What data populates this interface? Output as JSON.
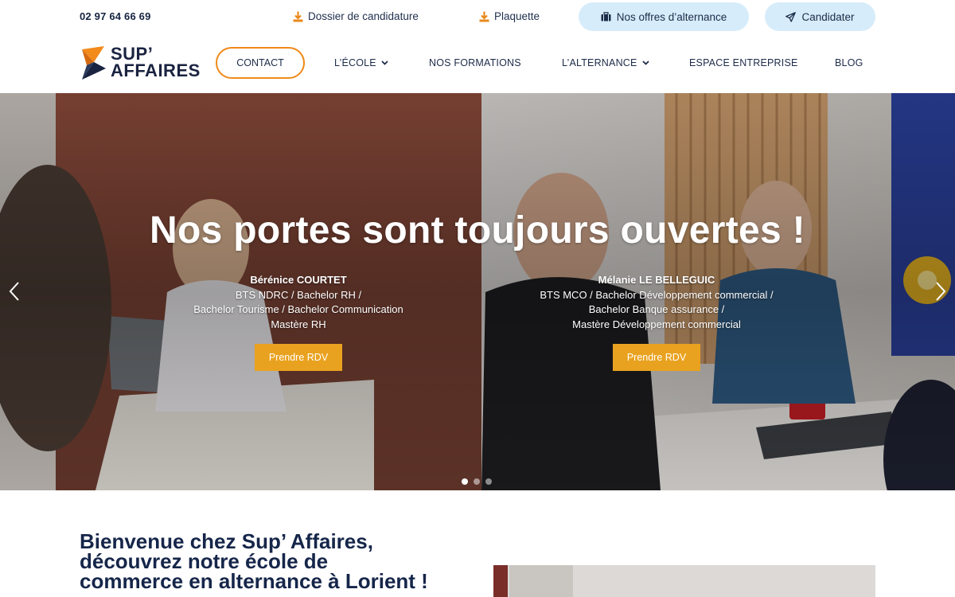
{
  "topbar": {
    "phone": "02 97 64 66 69",
    "links": [
      {
        "label": "Dossier de candidature",
        "icon": "download-icon"
      },
      {
        "label": "Plaquette",
        "icon": "download-icon"
      }
    ],
    "pills": [
      {
        "label": "Nos offres d’alternance",
        "icon": "briefcase-icon"
      },
      {
        "label": "Candidater",
        "icon": "paper-plane-icon"
      }
    ]
  },
  "nav": {
    "logo": {
      "line1": "SUP’",
      "line2": "AFFAIRES"
    },
    "contact": "CONTACT",
    "items": [
      {
        "label": "L’ÉCOLE",
        "has_dropdown": true
      },
      {
        "label": "NOS FORMATIONS",
        "has_dropdown": false
      },
      {
        "label": "L’ALTERNANCE",
        "has_dropdown": true
      },
      {
        "label": "ESPACE ENTREPRISE",
        "has_dropdown": false
      },
      {
        "label": "BLOG",
        "has_dropdown": false
      }
    ]
  },
  "hero": {
    "title": "Nos portes sont toujours ouvertes !",
    "people": [
      {
        "name": "Bérénice COURTET",
        "line1": "BTS NDRC / Bachelor RH /",
        "line2": "Bachelor Tourisme / Bachelor Communication",
        "line3": "Mastère RH",
        "button": "Prendre RDV"
      },
      {
        "name": "Mélanie LE BELLEGUIC",
        "line1": "BTS MCO / Bachelor Développement commercial /",
        "line2": "Bachelor Banque assurance /",
        "line3": "Mastère Développement commercial",
        "button": "Prendre RDV"
      }
    ],
    "slides_total": 3,
    "active_slide": 1
  },
  "welcome": {
    "line1": "Bienvenue chez Sup’ Affaires,",
    "line2": "découvrez notre école de",
    "line3": "commerce en alternance à Lorient !"
  },
  "colors": {
    "accent_orange": "#ef8a1a",
    "rdv_button": "#e9a21f",
    "pill_bg": "#d6ecfa",
    "navy": "#16264a"
  }
}
